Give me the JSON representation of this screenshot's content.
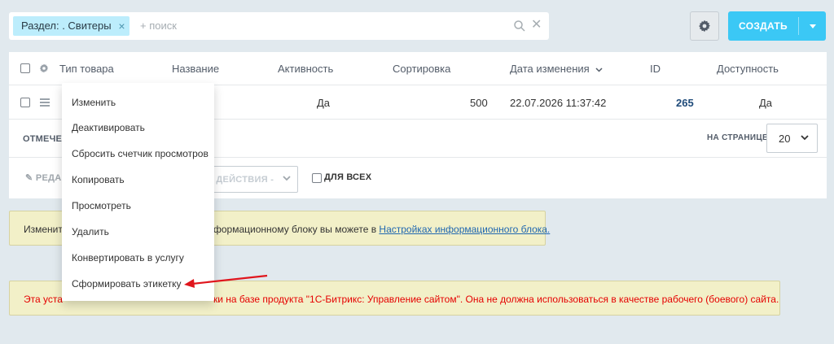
{
  "filter": {
    "tag_label": "Раздел: . Свитеры",
    "search_placeholder": "+ поиск"
  },
  "toolbar": {
    "create_label": "СОЗДАТЬ"
  },
  "grid": {
    "columns": [
      "Тип товара",
      "Название",
      "Активность",
      "Сортировка",
      "Дата изменения",
      "ID",
      "Доступность"
    ],
    "row": {
      "activity": "Да",
      "sort": "500",
      "date": "22.07.2026 11:37:42",
      "id": "265",
      "available": "Да"
    },
    "footer": {
      "checked_label": "ОТМЕЧЕН",
      "per_page_label": "НА СТРАНИЦЕ:",
      "per_page_value": "20"
    },
    "actions": {
      "edit_label": "РЕДА",
      "actions_select": "- ДЕЙСТВИЯ -",
      "for_all_label": "ДЛЯ ВСЕХ"
    }
  },
  "context_menu": {
    "items": [
      "Изменить",
      "Деактивировать",
      "Сбросить счетчик просмотров",
      "Копировать",
      "Просмотреть",
      "Удалить",
      "Конвертировать в услугу",
      "Сформировать этикетку"
    ]
  },
  "notices": {
    "info_start": "Изменит",
    "info_end": "формационному блоку вы можете в ",
    "info_link": "Настройках информационного блока.",
    "warning_start": "Эта уста",
    "warning_end": "ки на базе продукта \"1С-Битрикс: Управление сайтом\". Она не должна использоваться в качестве рабочего (боевого) сайта."
  },
  "colors": {
    "accent": "#3bc8f5",
    "annotation_arrow": "#e0161d",
    "warning_text": "#e50000"
  }
}
